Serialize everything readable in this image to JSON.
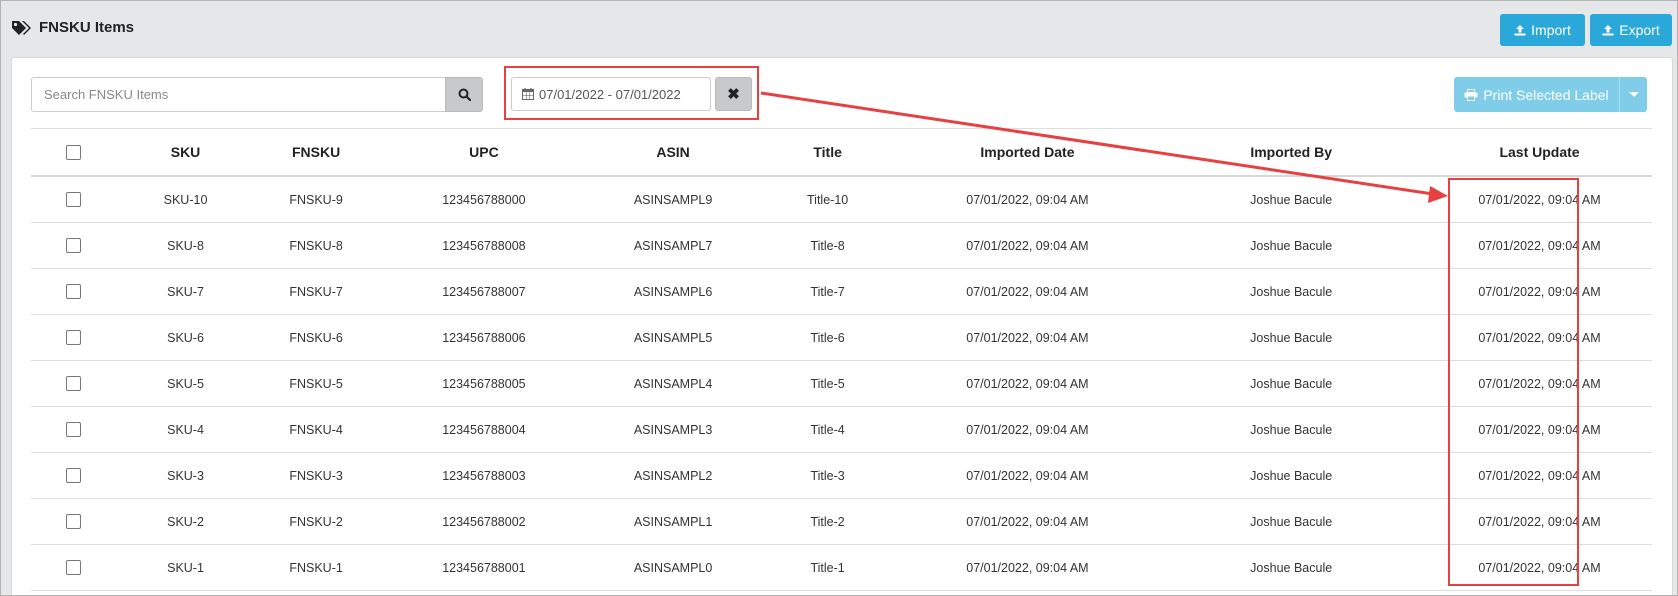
{
  "header": {
    "title": "FNSKU Items",
    "title_icon": "tags-icon",
    "import_label": "Import",
    "export_label": "Export"
  },
  "toolbar": {
    "search_placeholder": "Search FNSKU Items",
    "search_value": "",
    "date_range": "07/01/2022 - 07/01/2022",
    "print_label": "Print Selected Label"
  },
  "table": {
    "columns": [
      "SKU",
      "FNSKU",
      "UPC",
      "ASIN",
      "Title",
      "Imported Date",
      "Imported By",
      "Last Update"
    ],
    "rows": [
      {
        "sku": "SKU-10",
        "fnsku": "FNSKU-9",
        "upc": "123456788000",
        "asin": "ASINSAMPL9",
        "title": "Title-10",
        "imported_date": "07/01/2022, 09:04 AM",
        "imported_by": "Joshue Bacule",
        "last_update": "07/01/2022, 09:04 AM"
      },
      {
        "sku": "SKU-8",
        "fnsku": "FNSKU-8",
        "upc": "123456788008",
        "asin": "ASINSAMPL7",
        "title": "Title-8",
        "imported_date": "07/01/2022, 09:04 AM",
        "imported_by": "Joshue Bacule",
        "last_update": "07/01/2022, 09:04 AM"
      },
      {
        "sku": "SKU-7",
        "fnsku": "FNSKU-7",
        "upc": "123456788007",
        "asin": "ASINSAMPL6",
        "title": "Title-7",
        "imported_date": "07/01/2022, 09:04 AM",
        "imported_by": "Joshue Bacule",
        "last_update": "07/01/2022, 09:04 AM"
      },
      {
        "sku": "SKU-6",
        "fnsku": "FNSKU-6",
        "upc": "123456788006",
        "asin": "ASINSAMPL5",
        "title": "Title-6",
        "imported_date": "07/01/2022, 09:04 AM",
        "imported_by": "Joshue Bacule",
        "last_update": "07/01/2022, 09:04 AM"
      },
      {
        "sku": "SKU-5",
        "fnsku": "FNSKU-5",
        "upc": "123456788005",
        "asin": "ASINSAMPL4",
        "title": "Title-5",
        "imported_date": "07/01/2022, 09:04 AM",
        "imported_by": "Joshue Bacule",
        "last_update": "07/01/2022, 09:04 AM"
      },
      {
        "sku": "SKU-4",
        "fnsku": "FNSKU-4",
        "upc": "123456788004",
        "asin": "ASINSAMPL3",
        "title": "Title-4",
        "imported_date": "07/01/2022, 09:04 AM",
        "imported_by": "Joshue Bacule",
        "last_update": "07/01/2022, 09:04 AM"
      },
      {
        "sku": "SKU-3",
        "fnsku": "FNSKU-3",
        "upc": "123456788003",
        "asin": "ASINSAMPL2",
        "title": "Title-3",
        "imported_date": "07/01/2022, 09:04 AM",
        "imported_by": "Joshue Bacule",
        "last_update": "07/01/2022, 09:04 AM"
      },
      {
        "sku": "SKU-2",
        "fnsku": "FNSKU-2",
        "upc": "123456788002",
        "asin": "ASINSAMPL1",
        "title": "Title-2",
        "imported_date": "07/01/2022, 09:04 AM",
        "imported_by": "Joshue Bacule",
        "last_update": "07/01/2022, 09:04 AM"
      },
      {
        "sku": "SKU-1",
        "fnsku": "FNSKU-1",
        "upc": "123456788001",
        "asin": "ASINSAMPL0",
        "title": "Title-1",
        "imported_date": "07/01/2022, 09:04 AM",
        "imported_by": "Joshue Bacule",
        "last_update": "07/01/2022, 09:04 AM"
      }
    ]
  },
  "colors": {
    "primary_button": "#2aa8d9",
    "disabled_button": "#7fcde8",
    "annotation": "#e84040",
    "header_background": "#e6e7e8"
  }
}
